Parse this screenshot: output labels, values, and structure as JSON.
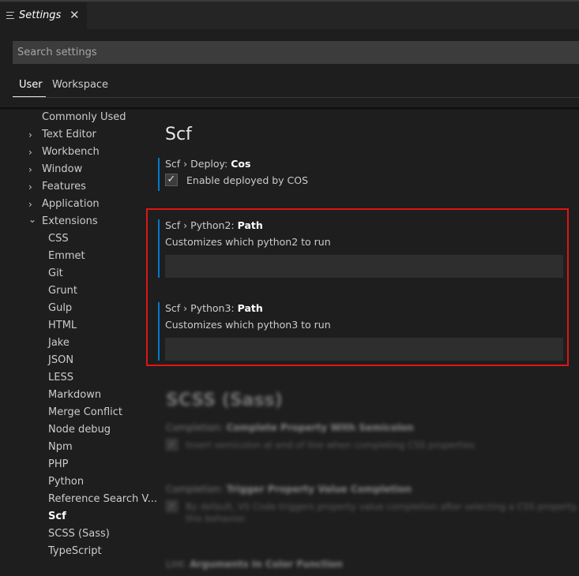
{
  "tab": {
    "title": "Settings",
    "close": "✕",
    "icon": "list-icon"
  },
  "search": {
    "placeholder": "Search settings",
    "value": ""
  },
  "scope_tabs": [
    {
      "label": "User",
      "active": true
    },
    {
      "label": "Workspace",
      "active": false
    }
  ],
  "toc": {
    "items": [
      {
        "label": "Commonly Used",
        "chevron": ""
      },
      {
        "label": "Text Editor",
        "chevron": "›"
      },
      {
        "label": "Workbench",
        "chevron": "›"
      },
      {
        "label": "Window",
        "chevron": "›"
      },
      {
        "label": "Features",
        "chevron": "›"
      },
      {
        "label": "Application",
        "chevron": "›"
      },
      {
        "label": "Extensions",
        "chevron": "⌄"
      },
      {
        "label": "CSS"
      },
      {
        "label": "Emmet"
      },
      {
        "label": "Git"
      },
      {
        "label": "Grunt"
      },
      {
        "label": "Gulp"
      },
      {
        "label": "HTML"
      },
      {
        "label": "Jake"
      },
      {
        "label": "JSON"
      },
      {
        "label": "LESS"
      },
      {
        "label": "Markdown"
      },
      {
        "label": "Merge Conflict"
      },
      {
        "label": "Node debug"
      },
      {
        "label": "Npm"
      },
      {
        "label": "PHP"
      },
      {
        "label": "Python"
      },
      {
        "label": "Reference Search V..."
      },
      {
        "label": "Scf",
        "selected": true
      },
      {
        "label": "SCSS (Sass)"
      },
      {
        "label": "TypeScript"
      }
    ]
  },
  "group": {
    "title": "Scf"
  },
  "settings": {
    "deploy": {
      "prefix": "Scf › Deploy: ",
      "name": "Cos",
      "checkbox_label": "Enable deployed by COS",
      "checked": "✓"
    },
    "python2": {
      "prefix": "Scf › Python2: ",
      "name": "Path",
      "description": "Customizes which python2 to run",
      "value": ""
    },
    "python3": {
      "prefix": "Scf › Python3: ",
      "name": "Path",
      "description": "Customizes which python3 to run",
      "value": ""
    }
  },
  "blurred": {
    "title": "SCSS (Sass)",
    "s1": {
      "prefix": "Completion: ",
      "name": "Complete Property With Semicolon",
      "desc": "Insert semicolon at end of line when completing CSS properties",
      "checked": "✓"
    },
    "s2": {
      "prefix": "Completion: ",
      "name": "Trigger Property Value Completion",
      "desc": "By default, VS Code triggers property value completion after selecting a CSS property.",
      "desc2": "this behavior.",
      "checked": "✓"
    },
    "s3": {
      "prefix": "Lint: ",
      "name": "Arguments In Color Function"
    }
  },
  "colors": {
    "accent": "#007acc",
    "highlight": "#e01515"
  }
}
